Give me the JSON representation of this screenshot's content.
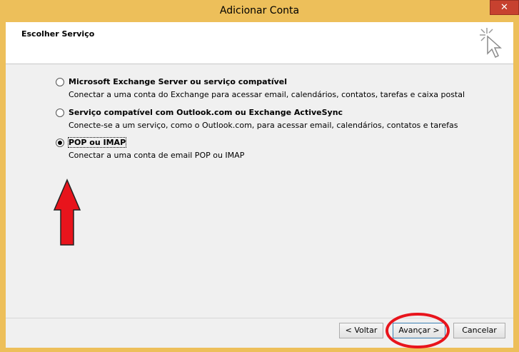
{
  "window": {
    "title": "Adicionar Conta",
    "close_glyph": "✕"
  },
  "header": {
    "title": "Escolher Serviço",
    "icon": "wizard-cursor-icon"
  },
  "options": [
    {
      "label": "Microsoft Exchange Server ou serviço compatível",
      "description": "Conectar a uma conta do Exchange para acessar email, calendários, contatos, tarefas e caixa postal",
      "checked": false
    },
    {
      "label": "Serviço compatível com Outlook.com ou Exchange ActiveSync",
      "description": "Conecte-se a um serviço, como o Outlook.com, para acessar email, calendários, contatos e tarefas",
      "checked": false
    },
    {
      "label": "POP ou IMAP",
      "description": "Conectar a uma conta de email POP ou IMAP",
      "checked": true
    }
  ],
  "buttons": {
    "back": "< Voltar",
    "next": "Avançar >",
    "cancel": "Cancelar"
  },
  "colors": {
    "title_bar": "#edbf5a",
    "close": "#c7412f",
    "annotation": "#e8141c"
  }
}
